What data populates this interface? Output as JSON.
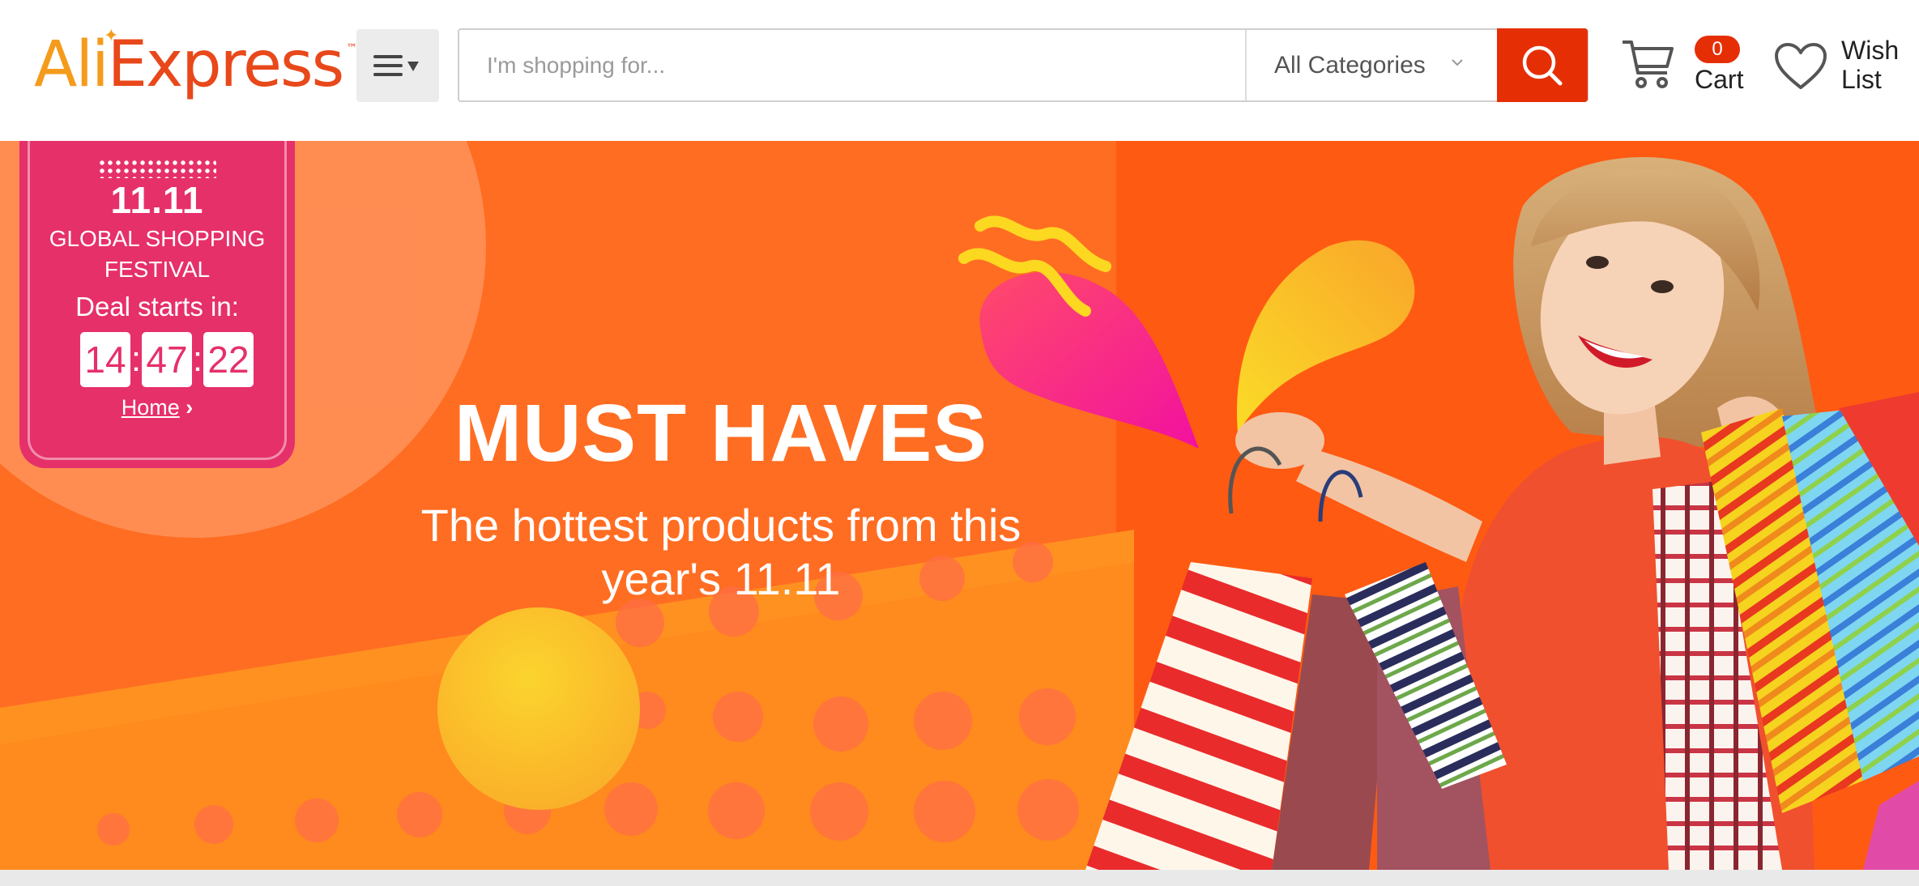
{
  "header": {
    "logo": {
      "part1": "Ali",
      "part2": "Express",
      "tm": "™"
    },
    "search": {
      "placeholder": "I'm shopping for...",
      "value": ""
    },
    "category": {
      "selected": "All Categories"
    },
    "cart": {
      "count": "0",
      "label": "Cart"
    },
    "wishlist": {
      "label": "Wish List"
    }
  },
  "banner": {
    "festival_badge": {
      "logo_text": "11.11",
      "title": "GLOBAL SHOPPING FESTIVAL",
      "deal_label": "Deal starts in:",
      "timer": {
        "hours": "14",
        "minutes": "47",
        "seconds": "22"
      },
      "link": "Home",
      "link_chevron": "›"
    },
    "headline": "MUST HAVES",
    "subheadline": "The hottest products from this year's 11.11"
  },
  "colors": {
    "accent": "#e62e04",
    "banner_orange": "#ff6d22",
    "badge_pink": "#e6306a",
    "logo_orange": "#f59b1c"
  }
}
